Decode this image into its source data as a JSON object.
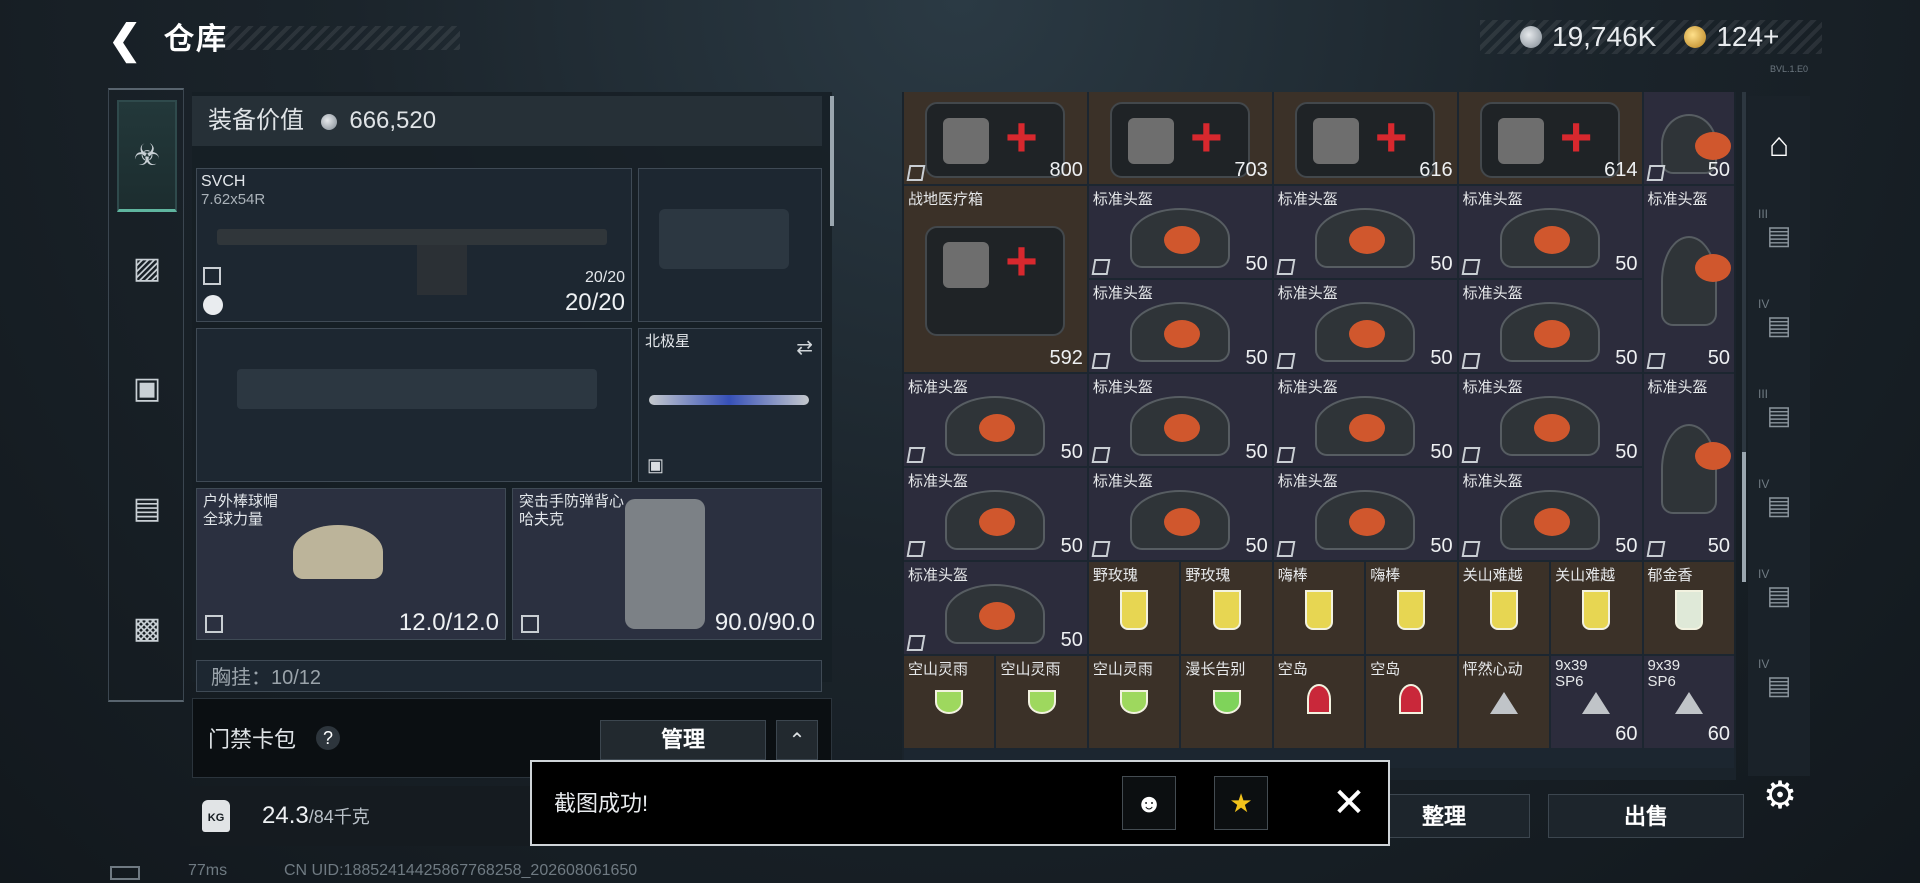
{
  "header": {
    "title": "仓库",
    "silver": "19,746K",
    "gold": "124+",
    "version": "BVL.1.E0"
  },
  "equipment": {
    "value_label": "装备价值",
    "value": "666,520",
    "primary": {
      "name": "SVCH",
      "caliber": "7.62x54R",
      "ammo_small": "20/20",
      "ammo": "20/20"
    },
    "melee": {
      "name": "北极星"
    },
    "helmet": {
      "name": "户外棒球帽",
      "sub": "全球力量",
      "durability": "12.0/12.0"
    },
    "armor": {
      "name": "突击手防弹背心",
      "sub": "哈夫克",
      "durability": "90.0/90.0"
    },
    "chest": {
      "label": "胸挂：10/12"
    }
  },
  "card_pack": {
    "title": "门禁卡包",
    "manage": "管理"
  },
  "weight": {
    "value": "24.3",
    "max": "/84千克"
  },
  "inventory": {
    "row1": [
      {
        "num": "800"
      },
      {
        "num": "703"
      },
      {
        "num": "616"
      },
      {
        "num": "614"
      },
      {
        "num": "50"
      }
    ],
    "med_name": "战地医疗箱",
    "med_num": "592",
    "helmet_name": "标准头盔",
    "helmet_num": "50",
    "drinks_row": [
      {
        "name": "野玫瑰"
      },
      {
        "name": "野玫瑰"
      },
      {
        "name": "嗨棒"
      },
      {
        "name": "嗨棒"
      },
      {
        "name": "关山难越"
      },
      {
        "name": "关山难越"
      },
      {
        "name": "郁金香"
      }
    ],
    "last_row": [
      {
        "name": "空山灵雨"
      },
      {
        "name": "空山灵雨"
      },
      {
        "name": "空山灵雨"
      },
      {
        "name": "漫长告别"
      },
      {
        "name": "空岛"
      },
      {
        "name": "空岛"
      },
      {
        "name": "怦然心动"
      },
      {
        "name": "9x39\nSP6",
        "num": "60"
      },
      {
        "name": "9x39\nSP6",
        "num": "60"
      }
    ]
  },
  "right_nav": {
    "items": [
      "III",
      "IV",
      "III",
      "IV",
      "IV",
      "IV"
    ]
  },
  "buttons": {
    "sort": "整理",
    "sell": "出售"
  },
  "toast": {
    "text": "截图成功!"
  },
  "status": {
    "ping": "77ms",
    "uid": "CN UID:18852414425867768258_202608061650"
  }
}
